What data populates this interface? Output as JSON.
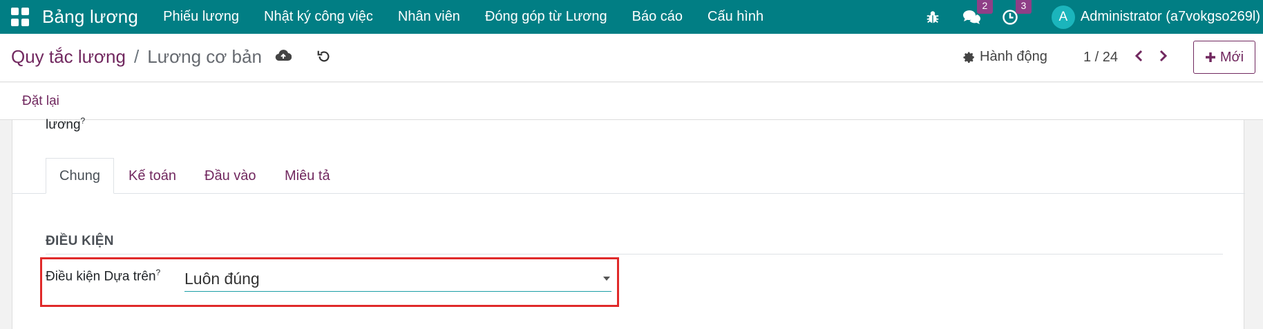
{
  "navbar": {
    "brand": "Bảng lương",
    "menu": [
      "Phiếu lương",
      "Nhật ký công việc",
      "Nhân viên",
      "Đóng góp từ Lương",
      "Báo cáo",
      "Cấu hình"
    ],
    "messages_count": "2",
    "activities_count": "3",
    "avatar_letter": "A",
    "user_name": "Administrator (a7vokgso269l)"
  },
  "control_panel": {
    "breadcrumb_parent": "Quy tắc lương",
    "breadcrumb_separator": "/",
    "breadcrumb_current": "Lương cơ bản",
    "action_label": "Hành động",
    "pager": "1 / 24",
    "new_label": "Mới"
  },
  "statusbar": {
    "reset_label": "Đặt lại"
  },
  "form": {
    "partial_label": "lương",
    "partial_help": "?",
    "tabs": [
      "Chung",
      "Kế toán",
      "Đầu vào",
      "Miêu tả"
    ],
    "section_title": "ĐIỀU KIỆN",
    "condition_label": "Điều kiện Dựa trên",
    "condition_help": "?",
    "condition_value": "Luôn đúng"
  },
  "colors": {
    "navbar": "#017e84",
    "brand_purple": "#71285f",
    "badge": "#8f3f87",
    "highlight": "#e02a2a"
  }
}
